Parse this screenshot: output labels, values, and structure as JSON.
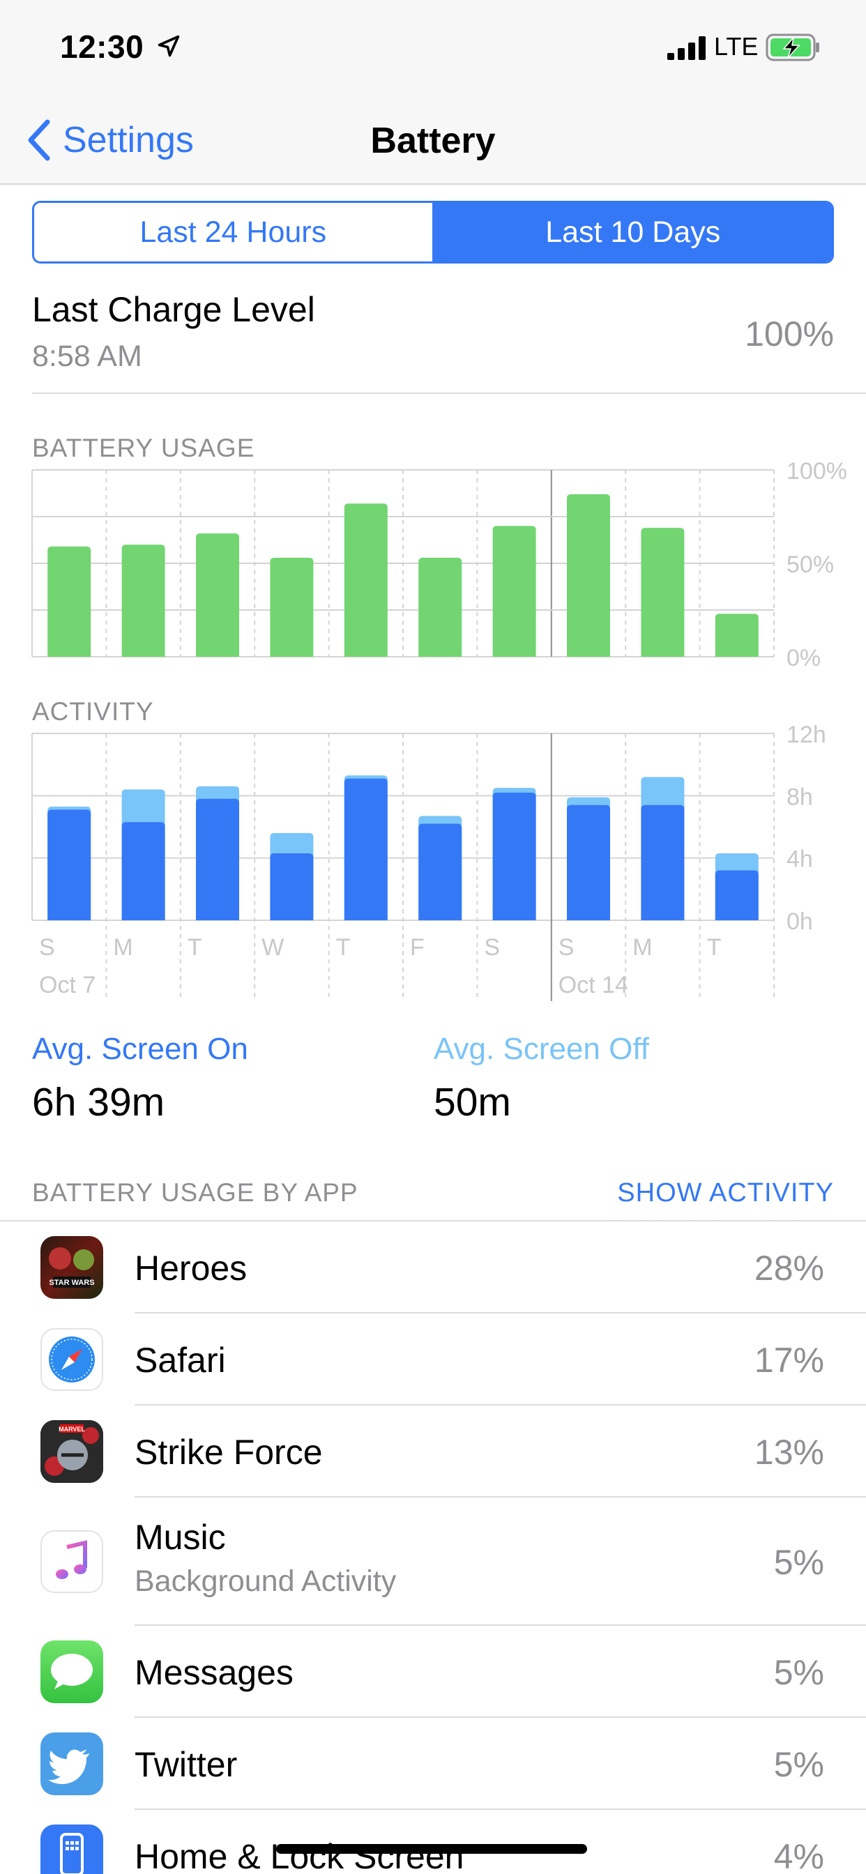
{
  "status_bar": {
    "time": "12:30",
    "network": "LTE",
    "icons": [
      "location-arrow-icon",
      "cell-signal-icon",
      "battery-charging-icon"
    ]
  },
  "nav": {
    "back_label": "Settings",
    "title": "Battery"
  },
  "segments": [
    {
      "label": "Last 24 Hours",
      "selected": false
    },
    {
      "label": "Last 10 Days",
      "selected": true
    }
  ],
  "last_charge": {
    "title": "Last Charge Level",
    "time": "8:58 AM",
    "value": "100%"
  },
  "colors": {
    "accent": "#3478f6",
    "usage_bar": "#72d572",
    "screen_on": "#3478f6",
    "screen_off": "#79c4f8",
    "axis_text": "#c7c7cc",
    "grid": "#d4d4d4"
  },
  "chart_data": [
    {
      "type": "bar",
      "title": "BATTERY USAGE",
      "categories": [
        "S",
        "M",
        "T",
        "W",
        "T",
        "F",
        "S",
        "S",
        "M",
        "T"
      ],
      "values": [
        59,
        60,
        66,
        53,
        82,
        53,
        70,
        87,
        69,
        23
      ],
      "ylim": [
        0,
        100
      ],
      "y_tick_labels": [
        "100%",
        "50%",
        "0%"
      ],
      "grid": true,
      "y_axis_position": "right"
    },
    {
      "type": "bar",
      "title": "ACTIVITY",
      "categories": [
        "S",
        "M",
        "T",
        "W",
        "T",
        "F",
        "S",
        "S",
        "M",
        "T"
      ],
      "series": [
        {
          "values": [
            7.1,
            6.3,
            7.8,
            4.3,
            9.1,
            6.2,
            8.2,
            7.4,
            7.4,
            3.2
          ]
        },
        {
          "values": [
            0.2,
            2.1,
            0.8,
            1.3,
            0.2,
            0.5,
            0.3,
            0.5,
            1.8,
            1.1
          ]
        }
      ],
      "stacked": true,
      "ylim": [
        0,
        12
      ],
      "y_tick_labels": [
        "12h",
        "8h",
        "4h",
        "0h"
      ],
      "date_labels": [
        {
          "text": "Oct 7",
          "index": 0
        },
        {
          "text": "Oct 14",
          "index": 7
        }
      ],
      "grid": true,
      "y_axis_position": "right"
    }
  ],
  "averages": {
    "screen_on_label": "Avg. Screen On",
    "screen_on_value": "6h 39m",
    "screen_off_label": "Avg. Screen Off",
    "screen_off_value": "50m"
  },
  "app_section": {
    "label": "BATTERY USAGE BY APP",
    "action": "SHOW ACTIVITY"
  },
  "apps": [
    {
      "name": "Heroes",
      "subtitle": "",
      "percent": "28%",
      "icon": "star-wars-heroes-icon"
    },
    {
      "name": "Safari",
      "subtitle": "",
      "percent": "17%",
      "icon": "safari-compass-icon"
    },
    {
      "name": "Strike Force",
      "subtitle": "",
      "percent": "13%",
      "icon": "marvel-strike-force-icon"
    },
    {
      "name": "Music",
      "subtitle": "Background Activity",
      "percent": "5%",
      "icon": "music-note-icon"
    },
    {
      "name": "Messages",
      "subtitle": "",
      "percent": "5%",
      "icon": "messages-bubble-icon"
    },
    {
      "name": "Twitter",
      "subtitle": "",
      "percent": "5%",
      "icon": "twitter-bird-icon"
    },
    {
      "name": "Home & Lock Screen",
      "subtitle": "",
      "percent": "4%",
      "icon": "phone-home-icon"
    }
  ]
}
